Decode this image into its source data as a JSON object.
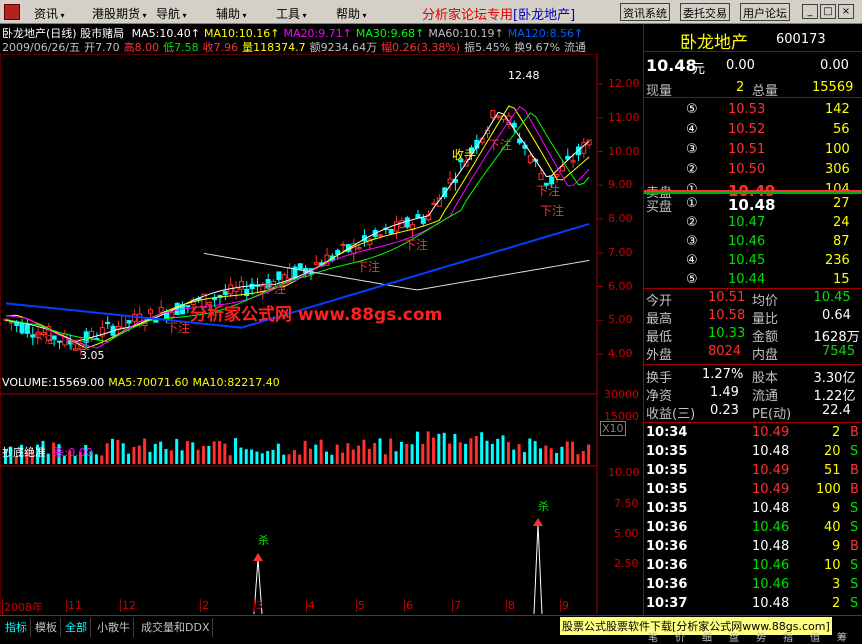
{
  "menu": {
    "items": [
      "资讯",
      "港股期货",
      "导航",
      "辅助",
      "工具",
      "帮助"
    ],
    "forum_title": "分析家论坛专用",
    "stock_tag": "[卧龙地产]",
    "buttons": [
      "资讯系统",
      "委托交易",
      "用户论坛"
    ],
    "win_buttons": [
      "_",
      "□",
      "×"
    ]
  },
  "chart": {
    "title_line": "卧龙地产(日线) 股市赌局",
    "ma": [
      {
        "label": "MA5:10.40",
        "color": "#ffffff"
      },
      {
        "label": "MA10:10.16",
        "color": "#ffff00"
      },
      {
        "label": "MA20:9.71",
        "color": "#ff00ff"
      },
      {
        "label": "MA30:9.68",
        "color": "#00ff00"
      },
      {
        "label": "MA60:10.19",
        "color": "#c0c0c0"
      },
      {
        "label": "MA120:8.56",
        "color": "#0060ff"
      }
    ],
    "quote_line": {
      "date": "2009/06/26/五",
      "open": "开7.70",
      "high": "高8.00",
      "low": "低7.58",
      "close": "收7.96",
      "volume": "量118374.7",
      "amount": "额9234.64万",
      "change": "幅0.26(3.38%)",
      "amplitude": "振5.45%",
      "turnover": "换9.67%",
      "circ": "流通"
    },
    "price_axis": [
      "12.00",
      "11.00",
      "10.00",
      "9.00",
      "8.00",
      "7.00",
      "6.00",
      "5.00",
      "4.00"
    ],
    "peak_label": "12.48",
    "trough_label": "3.05",
    "signals": [
      "下注",
      "下注",
      "下注",
      "下注",
      "下注",
      "下注",
      "收手",
      "下注",
      "下注",
      "下注"
    ],
    "watermark": "分析家公式网  www.88gs.com",
    "volume_line": {
      "vol": "VOLUME:15569.00",
      "ma5": "MA5:70071.60",
      "ma10": "MA10:82217.40"
    },
    "volume_axis": [
      "30000",
      "15000",
      "X10"
    ],
    "indicator_title": "抄底绝准",
    "indicator_value": "杀:0.00",
    "indicator_axis": [
      "10.00",
      "7.50",
      "5.00",
      "2.50"
    ],
    "indicator_mark": "杀",
    "time_axis": [
      "2008年",
      "11",
      "12",
      "2",
      "3",
      "4",
      "5",
      "6",
      "7",
      "8",
      "9"
    ]
  },
  "panel": {
    "name": "卧龙地产",
    "code": "600173",
    "price": "10.48",
    "price_unit": "元",
    "change": "0.00",
    "change_pct": "0.00",
    "now_vol_label": "现量",
    "now_vol": "2",
    "total_vol_label": "总量",
    "total_vol": "15569",
    "sell_label": "卖盘",
    "buy_label": "买盘",
    "asks": [
      {
        "lv": "⑤",
        "price": "10.53",
        "vol": "142"
      },
      {
        "lv": "④",
        "price": "10.52",
        "vol": "56"
      },
      {
        "lv": "③",
        "price": "10.51",
        "vol": "100"
      },
      {
        "lv": "②",
        "price": "10.50",
        "vol": "306"
      },
      {
        "lv": "①",
        "price": "10.49",
        "vol": "104"
      }
    ],
    "bids": [
      {
        "lv": "①",
        "price": "10.48",
        "vol": "27"
      },
      {
        "lv": "②",
        "price": "10.47",
        "vol": "24"
      },
      {
        "lv": "③",
        "price": "10.46",
        "vol": "87"
      },
      {
        "lv": "④",
        "price": "10.45",
        "vol": "236"
      },
      {
        "lv": "⑤",
        "price": "10.44",
        "vol": "15"
      }
    ],
    "stats": [
      {
        "l1": "今开",
        "v1": "10.51",
        "c1": "red",
        "l2": "均价",
        "v2": "10.45",
        "c2": "green"
      },
      {
        "l1": "最高",
        "v1": "10.58",
        "c1": "red",
        "l2": "量比",
        "v2": "0.64",
        "c2": "white"
      },
      {
        "l1": "最低",
        "v1": "10.33",
        "c1": "green",
        "l2": "金额",
        "v2": "1628万",
        "c2": "white"
      },
      {
        "l1": "外盘",
        "v1": "8024",
        "c1": "red",
        "l2": "内盘",
        "v2": "7545",
        "c2": "green"
      }
    ],
    "stats2": [
      {
        "l1": "换手",
        "v1": "1.27%",
        "l2": "股本",
        "v2": "3.30亿"
      },
      {
        "l1": "净资",
        "v1": "1.49",
        "l2": "流通",
        "v2": "1.22亿"
      },
      {
        "l1": "收益(三)",
        "v1": "0.23",
        "l2": "PE(动)",
        "v2": "22.4"
      }
    ],
    "ticks": [
      {
        "t": "10:34",
        "p": "10.49",
        "c": "red",
        "v": "2",
        "s": "B"
      },
      {
        "t": "10:35",
        "p": "10.48",
        "c": "white",
        "v": "20",
        "s": "S"
      },
      {
        "t": "10:35",
        "p": "10.49",
        "c": "red",
        "v": "51",
        "s": "B"
      },
      {
        "t": "10:35",
        "p": "10.49",
        "c": "red",
        "v": "100",
        "s": "B"
      },
      {
        "t": "10:35",
        "p": "10.48",
        "c": "white",
        "v": "9",
        "s": "S"
      },
      {
        "t": "10:36",
        "p": "10.46",
        "c": "green",
        "v": "40",
        "s": "S"
      },
      {
        "t": "10:36",
        "p": "10.48",
        "c": "white",
        "v": "9",
        "s": "B"
      },
      {
        "t": "10:36",
        "p": "10.46",
        "c": "green",
        "v": "10",
        "s": "S"
      },
      {
        "t": "10:36",
        "p": "10.46",
        "c": "green",
        "v": "3",
        "s": "S"
      },
      {
        "t": "10:37",
        "p": "10.48",
        "c": "white",
        "v": "2",
        "s": "S"
      }
    ]
  },
  "tabs": [
    "指标",
    "模板",
    "全部",
    "小散牛",
    "成交量和DDX"
  ],
  "bottom_banner": "股票公式股票软件下载[分析家公式网www.88gs.com]",
  "bottom_small": [
    "笔",
    "价",
    "细",
    "盘",
    "势",
    "指",
    "值",
    "筹"
  ]
}
